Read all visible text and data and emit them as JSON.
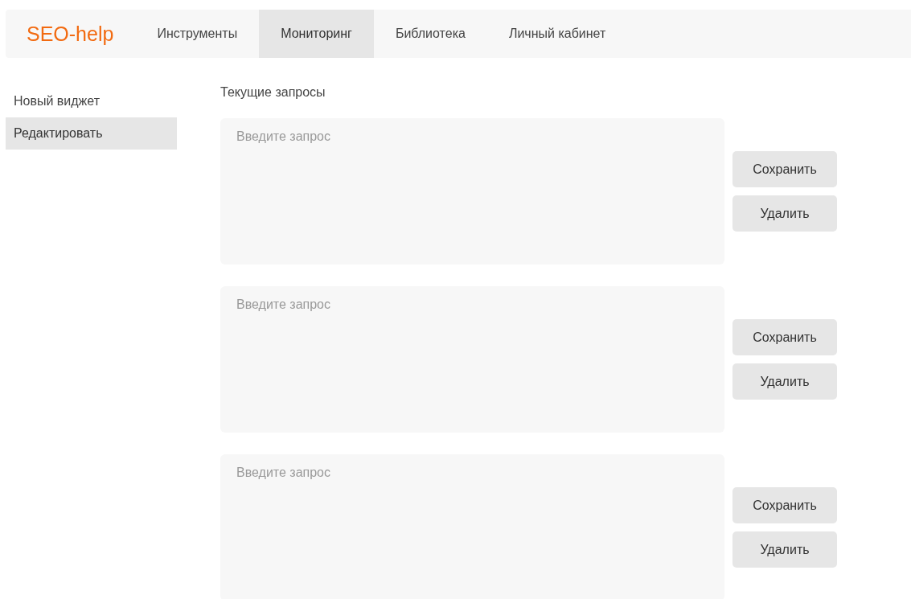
{
  "logo": "SEO-help",
  "nav": [
    {
      "label": "Инструменты",
      "selected": false
    },
    {
      "label": "Мониторинг",
      "selected": true
    },
    {
      "label": "Библиотека",
      "selected": false
    },
    {
      "label": "Личный кабинет",
      "selected": false
    }
  ],
  "sidebar": {
    "items": [
      {
        "label": "Новый виджет",
        "selected": false
      },
      {
        "label": "Редактировать",
        "selected": true
      }
    ]
  },
  "section_title": "Текущие запросы",
  "queries": [
    {
      "placeholder": "Введите запрос",
      "buttons": [
        "Сохранить",
        "Удалить"
      ]
    },
    {
      "placeholder": "Введите запрос",
      "buttons": [
        "Сохранить",
        "Удалить"
      ]
    },
    {
      "placeholder": "Введите запрос",
      "buttons": [
        "Сохранить",
        "Удалить"
      ]
    }
  ]
}
